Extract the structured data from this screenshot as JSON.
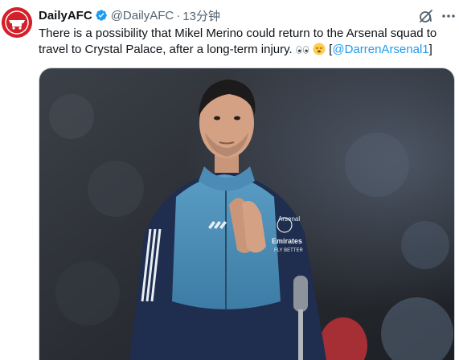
{
  "account": {
    "display_name": "DailyAFC",
    "handle": "@DailyAFC",
    "separator": "·",
    "time": "13分钟"
  },
  "tweet": {
    "text_before": "There is a possibility that Mikel Merino could return to the Arsenal squad to travel to Crystal Palace, after a long-term injury. ",
    "emojis": "👀 😴",
    "bracket_open": " [",
    "mention": "@DarrenArsenal1",
    "bracket_close": "]"
  },
  "photo": {
    "jacket_badge": "Arsenal",
    "sponsor_line1": "Emirates",
    "sponsor_line2": "FLY BETTER"
  },
  "icons": {
    "verified": "verified-badge-icon",
    "grok": "grok-icon",
    "more": "more-options-icon"
  },
  "colors": {
    "link": "#1d9bf0",
    "secondary_text": "#536471",
    "avatar_bg": "#d3202a"
  }
}
